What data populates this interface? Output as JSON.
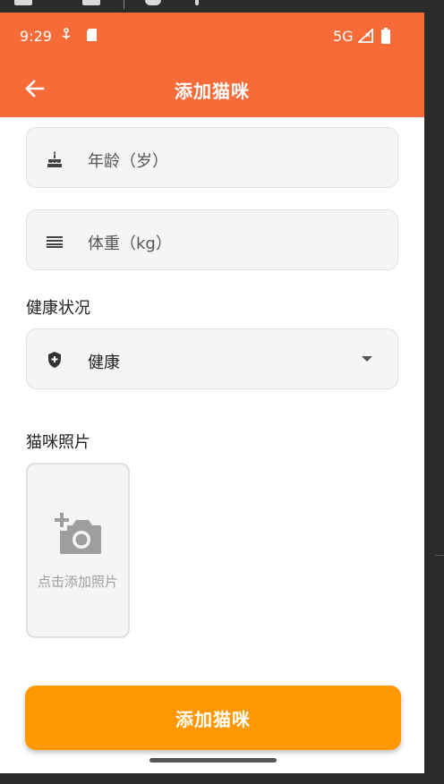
{
  "status_bar": {
    "time": "9:29",
    "network": "5G"
  },
  "app_bar": {
    "title": "添加猫咪"
  },
  "form": {
    "age_placeholder": "年龄（岁）",
    "weight_placeholder": "体重（kg）",
    "health_label": "健康状况",
    "health_value": "健康",
    "photo_label": "猫咪照片",
    "photo_hint": "点击添加照片"
  },
  "submit_label": "添加猫咪",
  "icons": {
    "back": "arrow-left-icon",
    "age": "cake-icon",
    "weight": "lines-icon",
    "health": "shield-plus-icon",
    "photo": "add-photo-icon"
  },
  "colors": {
    "app_bar": "#f76b38",
    "submit": "#ff9800",
    "field_bg": "#f5f5f5"
  }
}
